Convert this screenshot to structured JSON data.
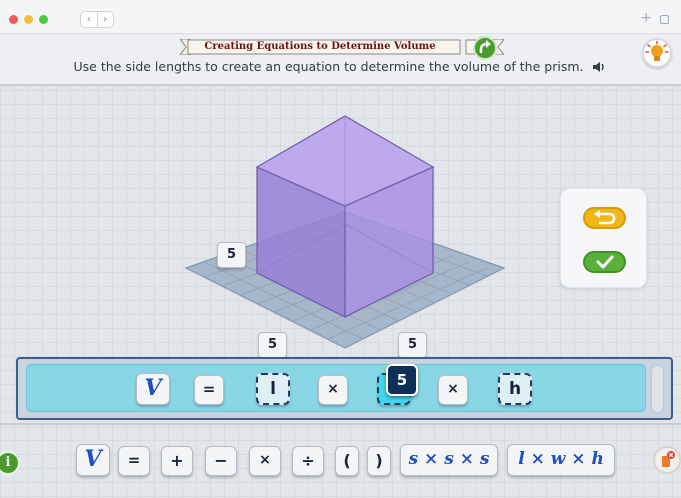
{
  "browser": {
    "back_icon": "chevron-left-icon",
    "forward_icon": "chevron-right-icon",
    "new_tab_label": "+"
  },
  "header": {
    "title": "Creating Equations to Determine Volume",
    "instructions": "Use the side lengths to create an equation to determine the volume of the prism."
  },
  "prism": {
    "side_labels": [
      "5",
      "5",
      "5"
    ]
  },
  "equation": {
    "tiles": [
      "V",
      "=",
      "l",
      "×",
      "",
      "×",
      "h"
    ],
    "popup_value": "5"
  },
  "palette": {
    "tiles": [
      "V",
      "=",
      "+",
      "−",
      "×",
      "÷",
      "(",
      ")",
      "s × s × s",
      "l × w × h"
    ]
  },
  "footer": {
    "info_label": "i"
  },
  "colors": {
    "accent_blue": "#1f4fbf",
    "equation_bar": "#88d6e5",
    "prism_fill": "#a48ee0",
    "undo_button": "#f2b516",
    "check_button": "#59b13a"
  }
}
